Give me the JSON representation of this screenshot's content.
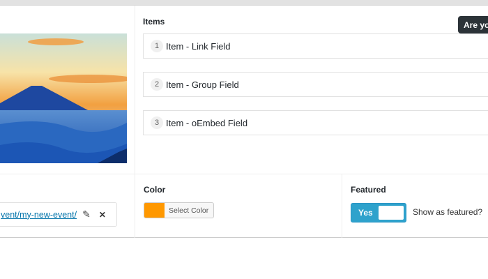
{
  "tooltip": "Are yo",
  "items": {
    "label": "Items",
    "rows": [
      {
        "num": "1",
        "label": "Item - Link Field"
      },
      {
        "num": "2",
        "label": "Item - Group Field"
      },
      {
        "num": "3",
        "label": "Item - oEmbed Field"
      }
    ]
  },
  "link": {
    "url": "vent/my-new-event/"
  },
  "color": {
    "label": "Color",
    "button": "Select Color",
    "value": "#ff9800"
  },
  "featured": {
    "label": "Featured",
    "toggle": "Yes",
    "hint": "Show as featured?"
  }
}
